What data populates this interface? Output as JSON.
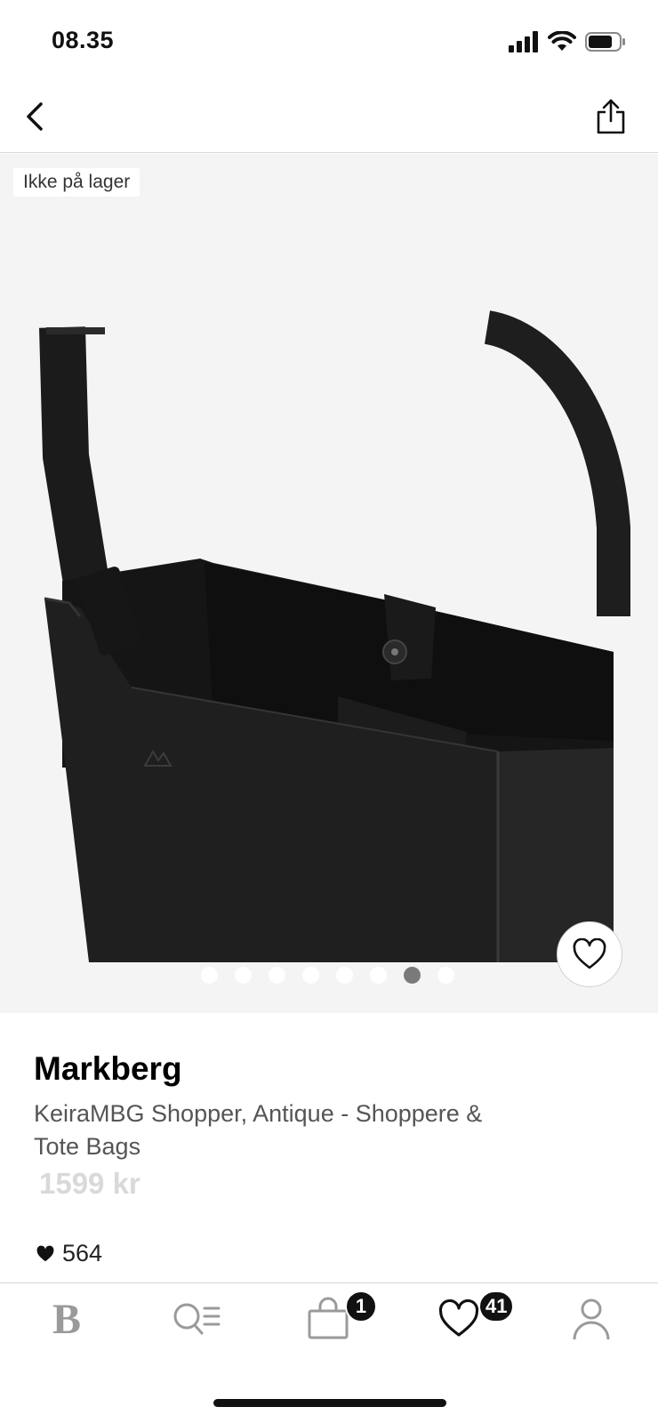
{
  "status_bar": {
    "time": "08.35"
  },
  "nav": {
    "back_icon": "chevron-left-icon",
    "share_icon": "share-icon"
  },
  "gallery": {
    "stock_badge": "Ikke på lager",
    "image_count": 8,
    "active_image_index": 6,
    "favorite_icon": "heart-outline-icon"
  },
  "product": {
    "brand": "Markberg",
    "name": "KeiraMBG Shopper, Antique - Shoppere & Tote Bags",
    "price": "1599 kr",
    "likes": "564"
  },
  "tab_bar": {
    "home_logo": "B",
    "bag_badge": "1",
    "favorites_badge": "41"
  },
  "colors": {
    "accent": "#111111",
    "gallery_bg": "#f4f4f4",
    "price_muted": "#d9d9d9"
  }
}
